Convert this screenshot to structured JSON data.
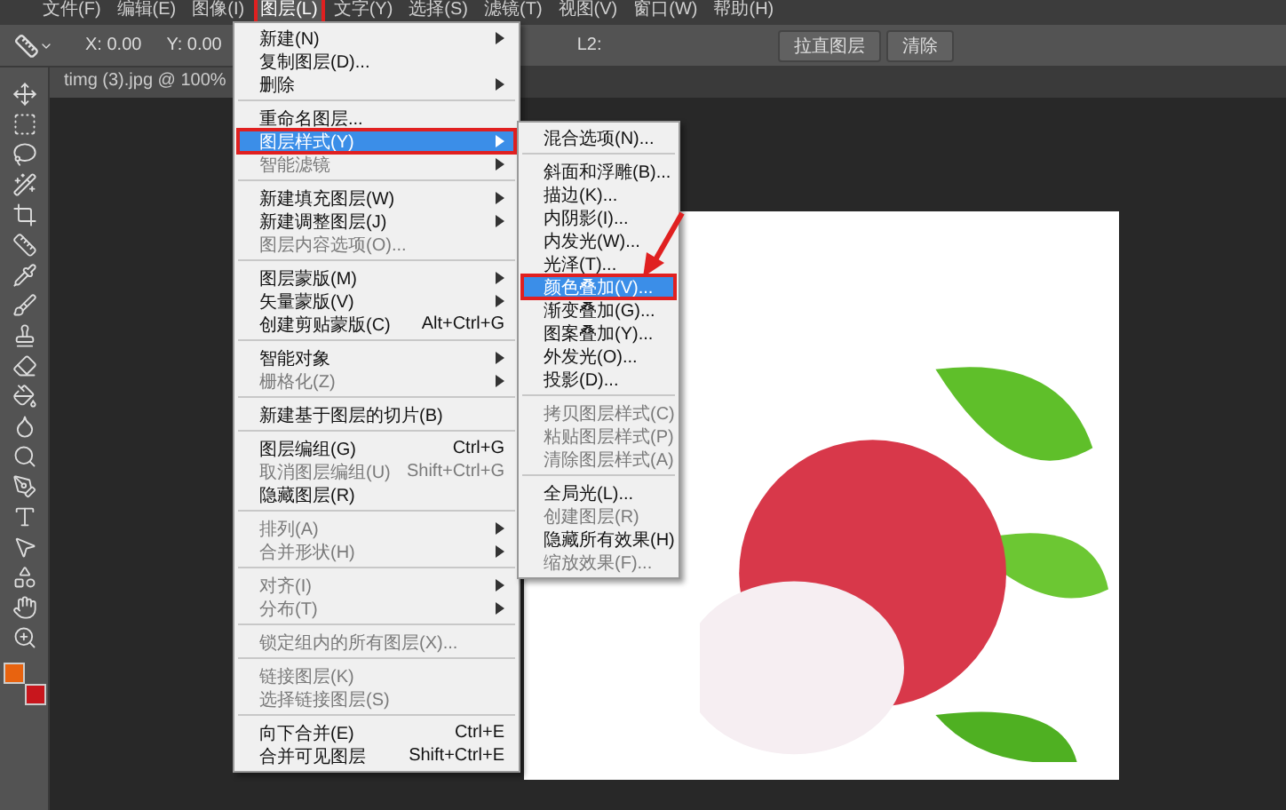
{
  "menubar": [
    {
      "label": "文件(F)",
      "selected": false,
      "annotated": false
    },
    {
      "label": "编辑(E)",
      "selected": false,
      "annotated": false
    },
    {
      "label": "图像(I)",
      "selected": false,
      "annotated": false
    },
    {
      "label": "图层(L)",
      "selected": true,
      "annotated": true
    },
    {
      "label": "文字(Y)",
      "selected": false,
      "annotated": false
    },
    {
      "label": "选择(S)",
      "selected": false,
      "annotated": false
    },
    {
      "label": "滤镜(T)",
      "selected": false,
      "annotated": false
    },
    {
      "label": "视图(V)",
      "selected": false,
      "annotated": false
    },
    {
      "label": "窗口(W)",
      "selected": false,
      "annotated": false
    },
    {
      "label": "帮助(H)",
      "selected": false,
      "annotated": false
    }
  ],
  "options_bar": {
    "x": "X: 0.00",
    "y": "Y: 0.00",
    "l2": "L2:",
    "buttons": [
      "拉直图层",
      "清除"
    ]
  },
  "document_tab": {
    "title": "timg (3).jpg @ 100%"
  },
  "layer_menu": [
    {
      "kind": "item",
      "label": "新建(N)",
      "submenu": true,
      "disabled": false,
      "selected": false,
      "annotated": false
    },
    {
      "kind": "item",
      "label": "复制图层(D)...",
      "submenu": false,
      "disabled": false,
      "selected": false,
      "annotated": false
    },
    {
      "kind": "item",
      "label": "删除",
      "submenu": true,
      "disabled": false,
      "selected": false,
      "annotated": false
    },
    {
      "kind": "separator"
    },
    {
      "kind": "item",
      "label": "重命名图层...",
      "submenu": false,
      "disabled": false,
      "selected": false,
      "annotated": false
    },
    {
      "kind": "item",
      "label": "图层样式(Y)",
      "submenu": true,
      "disabled": false,
      "selected": true,
      "annotated": true
    },
    {
      "kind": "item",
      "label": "智能滤镜",
      "submenu": true,
      "disabled": true,
      "selected": false,
      "annotated": false
    },
    {
      "kind": "separator"
    },
    {
      "kind": "item",
      "label": "新建填充图层(W)",
      "submenu": true,
      "disabled": false,
      "selected": false,
      "annotated": false
    },
    {
      "kind": "item",
      "label": "新建调整图层(J)",
      "submenu": true,
      "disabled": false,
      "selected": false,
      "annotated": false
    },
    {
      "kind": "item",
      "label": "图层内容选项(O)...",
      "submenu": false,
      "disabled": true,
      "selected": false,
      "annotated": false
    },
    {
      "kind": "separator"
    },
    {
      "kind": "item",
      "label": "图层蒙版(M)",
      "submenu": true,
      "disabled": false,
      "selected": false,
      "annotated": false
    },
    {
      "kind": "item",
      "label": "矢量蒙版(V)",
      "submenu": true,
      "disabled": false,
      "selected": false,
      "annotated": false
    },
    {
      "kind": "item",
      "label": "创建剪贴蒙版(C)",
      "shortcut": "Alt+Ctrl+G",
      "submenu": false,
      "disabled": false,
      "selected": false,
      "annotated": false
    },
    {
      "kind": "separator"
    },
    {
      "kind": "item",
      "label": "智能对象",
      "submenu": true,
      "disabled": false,
      "selected": false,
      "annotated": false
    },
    {
      "kind": "item",
      "label": "栅格化(Z)",
      "submenu": true,
      "disabled": true,
      "selected": false,
      "annotated": false
    },
    {
      "kind": "separator"
    },
    {
      "kind": "item",
      "label": "新建基于图层的切片(B)",
      "submenu": false,
      "disabled": false,
      "selected": false,
      "annotated": false
    },
    {
      "kind": "separator"
    },
    {
      "kind": "item",
      "label": "图层编组(G)",
      "shortcut": "Ctrl+G",
      "submenu": false,
      "disabled": false,
      "selected": false,
      "annotated": false
    },
    {
      "kind": "item",
      "label": "取消图层编组(U)",
      "shortcut": "Shift+Ctrl+G",
      "submenu": false,
      "disabled": true,
      "selected": false,
      "annotated": false
    },
    {
      "kind": "item",
      "label": "隐藏图层(R)",
      "submenu": false,
      "disabled": false,
      "selected": false,
      "annotated": false
    },
    {
      "kind": "separator"
    },
    {
      "kind": "item",
      "label": "排列(A)",
      "submenu": true,
      "disabled": true,
      "selected": false,
      "annotated": false
    },
    {
      "kind": "item",
      "label": "合并形状(H)",
      "submenu": true,
      "disabled": true,
      "selected": false,
      "annotated": false
    },
    {
      "kind": "separator"
    },
    {
      "kind": "item",
      "label": "对齐(I)",
      "submenu": true,
      "disabled": true,
      "selected": false,
      "annotated": false
    },
    {
      "kind": "item",
      "label": "分布(T)",
      "submenu": true,
      "disabled": true,
      "selected": false,
      "annotated": false
    },
    {
      "kind": "separator"
    },
    {
      "kind": "item",
      "label": "锁定组内的所有图层(X)...",
      "submenu": false,
      "disabled": true,
      "selected": false,
      "annotated": false
    },
    {
      "kind": "separator"
    },
    {
      "kind": "item",
      "label": "链接图层(K)",
      "submenu": false,
      "disabled": true,
      "selected": false,
      "annotated": false
    },
    {
      "kind": "item",
      "label": "选择链接图层(S)",
      "submenu": false,
      "disabled": true,
      "selected": false,
      "annotated": false
    },
    {
      "kind": "separator"
    },
    {
      "kind": "item",
      "label": "向下合并(E)",
      "shortcut": "Ctrl+E",
      "submenu": false,
      "disabled": false,
      "selected": false,
      "annotated": false
    },
    {
      "kind": "item",
      "label": "合并可见图层",
      "shortcut": "Shift+Ctrl+E",
      "submenu": false,
      "disabled": false,
      "selected": false,
      "annotated": false
    }
  ],
  "style_submenu": [
    {
      "kind": "item",
      "label": "混合选项(N)...",
      "disabled": false,
      "selected": false,
      "annotated": false
    },
    {
      "kind": "separator"
    },
    {
      "kind": "item",
      "label": "斜面和浮雕(B)...",
      "disabled": false,
      "selected": false,
      "annotated": false
    },
    {
      "kind": "item",
      "label": "描边(K)...",
      "disabled": false,
      "selected": false,
      "annotated": false
    },
    {
      "kind": "item",
      "label": "内阴影(I)...",
      "disabled": false,
      "selected": false,
      "annotated": false
    },
    {
      "kind": "item",
      "label": "内发光(W)...",
      "disabled": false,
      "selected": false,
      "annotated": false
    },
    {
      "kind": "item",
      "label": "光泽(T)...",
      "disabled": false,
      "selected": false,
      "annotated": false
    },
    {
      "kind": "item",
      "label": "颜色叠加(V)...",
      "disabled": false,
      "selected": true,
      "annotated": true
    },
    {
      "kind": "item",
      "label": "渐变叠加(G)...",
      "disabled": false,
      "selected": false,
      "annotated": false
    },
    {
      "kind": "item",
      "label": "图案叠加(Y)...",
      "disabled": false,
      "selected": false,
      "annotated": false
    },
    {
      "kind": "item",
      "label": "外发光(O)...",
      "disabled": false,
      "selected": false,
      "annotated": false
    },
    {
      "kind": "item",
      "label": "投影(D)...",
      "disabled": false,
      "selected": false,
      "annotated": false
    },
    {
      "kind": "separator"
    },
    {
      "kind": "item",
      "label": "拷贝图层样式(C)",
      "disabled": true,
      "selected": false,
      "annotated": false
    },
    {
      "kind": "item",
      "label": "粘贴图层样式(P)",
      "disabled": true,
      "selected": false,
      "annotated": false
    },
    {
      "kind": "item",
      "label": "清除图层样式(A)",
      "disabled": true,
      "selected": false,
      "annotated": false
    },
    {
      "kind": "separator"
    },
    {
      "kind": "item",
      "label": "全局光(L)...",
      "disabled": false,
      "selected": false,
      "annotated": false
    },
    {
      "kind": "item",
      "label": "创建图层(R)",
      "disabled": true,
      "selected": false,
      "annotated": false
    },
    {
      "kind": "item",
      "label": "隐藏所有效果(H)",
      "disabled": false,
      "selected": false,
      "annotated": false
    },
    {
      "kind": "item",
      "label": "缩放效果(F)...",
      "disabled": true,
      "selected": false,
      "annotated": false
    }
  ]
}
